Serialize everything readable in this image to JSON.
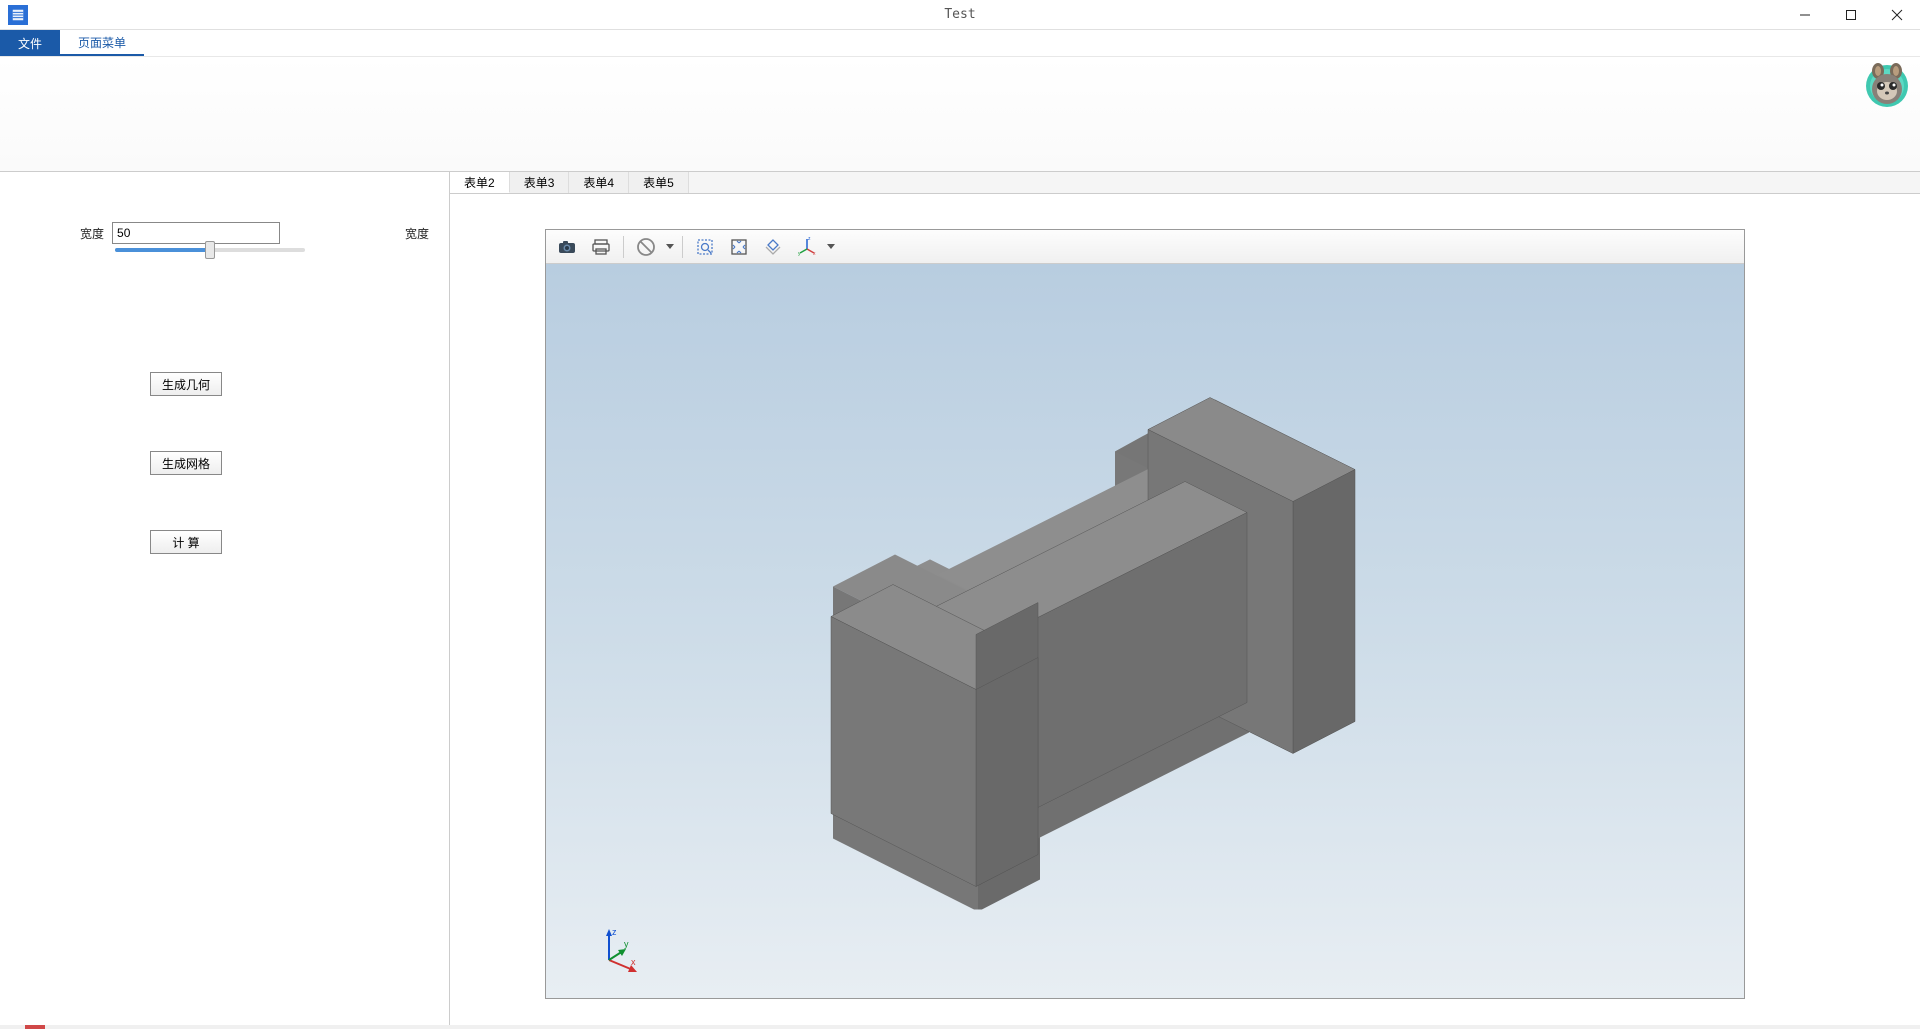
{
  "window": {
    "title": "Test"
  },
  "menu": {
    "file": "文件",
    "page_menu": "页面菜单"
  },
  "left_panel": {
    "width_label": "宽度",
    "width_value": "50",
    "width_label_right": "宽度",
    "btn_geometry": "生成几何",
    "btn_mesh": "生成网格",
    "btn_compute": "计 算"
  },
  "tabs": [
    {
      "label": "表单2",
      "active": true
    },
    {
      "label": "表单3",
      "active": false
    },
    {
      "label": "表单4",
      "active": false
    },
    {
      "label": "表单5",
      "active": false
    }
  ],
  "viewport_toolbar_icons": [
    "camera",
    "print",
    "stop-dropdown",
    "zoom-region",
    "zoom-fit",
    "rotate-view",
    "axis-toggle"
  ],
  "axis": {
    "x": "x",
    "y": "y",
    "z": "z"
  }
}
